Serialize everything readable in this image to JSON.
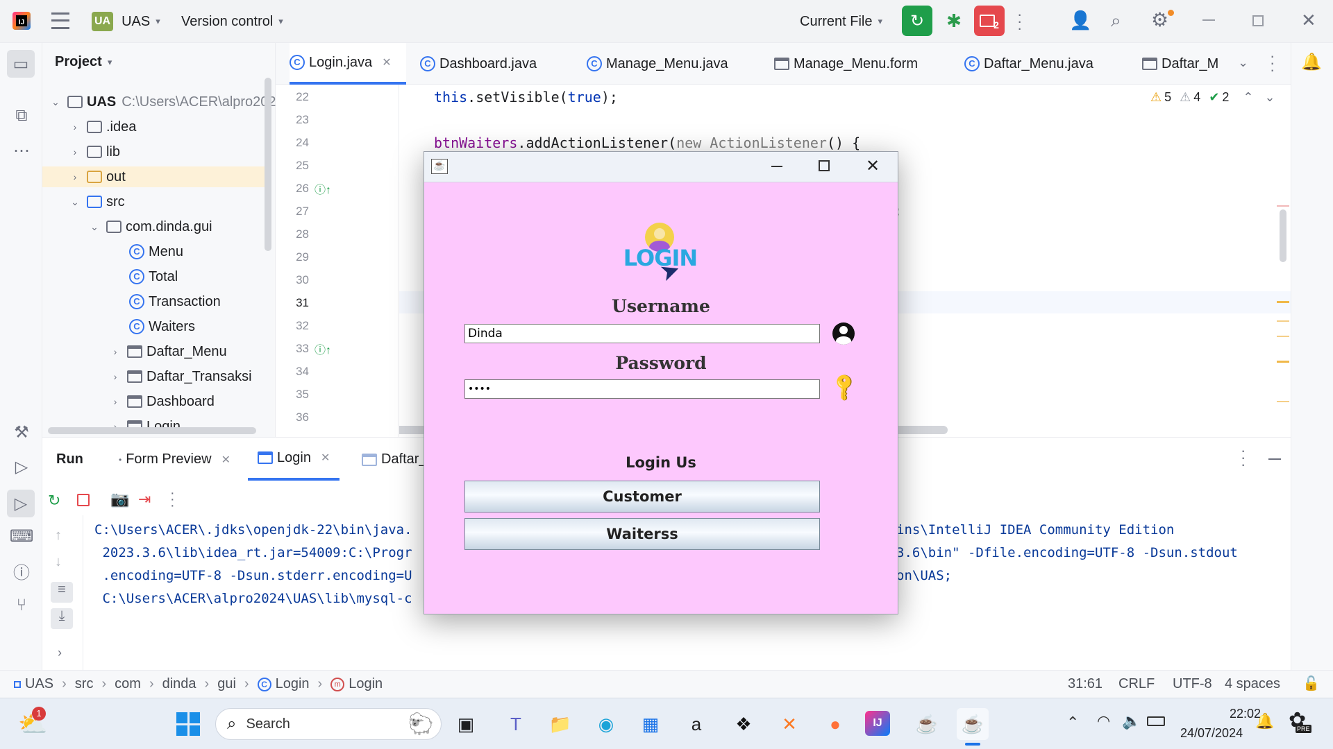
{
  "topbar": {
    "project_badge": "UA",
    "project_name": "UAS",
    "vcs": "Version control",
    "run_config": "Current File",
    "vcs_count": "2"
  },
  "project_panel": {
    "title": "Project",
    "root_name": "UAS",
    "root_path": "C:\\Users\\ACER\\alpro2024",
    "items": [
      {
        "label": ".idea"
      },
      {
        "label": "lib"
      },
      {
        "label": "out"
      },
      {
        "label": "src"
      },
      {
        "label": "com.dinda.gui"
      },
      {
        "label": "Menu"
      },
      {
        "label": "Total"
      },
      {
        "label": "Transaction"
      },
      {
        "label": "Waiters"
      },
      {
        "label": "Daftar_Menu"
      },
      {
        "label": "Daftar_Transaksi"
      },
      {
        "label": "Dashboard"
      },
      {
        "label": "Login"
      }
    ]
  },
  "editor": {
    "tabs": [
      "Login.java",
      "Dashboard.java",
      "Manage_Menu.java",
      "Manage_Menu.form",
      "Daftar_Menu.java",
      "Daftar_M"
    ],
    "inspections": {
      "warn": "5",
      "weak": "4",
      "ok": "2"
    },
    "lines": [
      "22",
      "23",
      "24",
      "25",
      "26",
      "27",
      "28",
      "29",
      "30",
      "31",
      "32",
      "33",
      "34",
      "35",
      "36"
    ],
    "code": {
      "l22_a": "this",
      "l22_b": ".setVisible(",
      "l22_c": "true",
      "l22_d": ");",
      "l24_a": "btnWaiters",
      "l24_b": ".addActionListener(",
      "l24_c": "new",
      "l24_d": " ActionListener",
      "l24_e": "() {",
      "l27_tail": ";"
    }
  },
  "run_panel": {
    "title": "Run",
    "tabs": [
      "Form Preview",
      "Login",
      "Daftar_"
    ],
    "console": [
      "C:\\Users\\ACER\\.jdks\\openjdk-22\\bin\\java.",
      " 2023.3.6\\lib\\idea_rt.jar=54009:C:\\Progr",
      " .encoding=UTF-8 -Dsun.stderr.encoding=U",
      " C:\\Users\\ACER\\alpro2024\\UAS\\lib\\mysql-c"
    ],
    "console_right": [
      "ins\\IntelliJ IDEA Community Edition",
      "3.6\\bin\" -Dfile.encoding=UTF-8 -Dsun.stdout",
      "on\\UAS;",
      ""
    ]
  },
  "status_bar": {
    "breadcrumbs": [
      "UAS",
      "src",
      "com",
      "dinda",
      "gui",
      "Login",
      "Login"
    ],
    "position": "31:61",
    "line_sep": "CRLF",
    "encoding": "UTF-8",
    "indent": "4 spaces"
  },
  "dialog": {
    "logo_text": "LOGIN",
    "username_label": "Username",
    "username_value": "Dinda",
    "password_label": "Password",
    "password_value": "••••",
    "login_us": "Login Us",
    "customer_btn": "Customer",
    "waiterss_btn": "Waiterss"
  },
  "taskbar": {
    "weather_badge": "1",
    "search_placeholder": "Search",
    "time": "22:02",
    "date": "24/07/2024",
    "copilot_badge": "PRE"
  }
}
